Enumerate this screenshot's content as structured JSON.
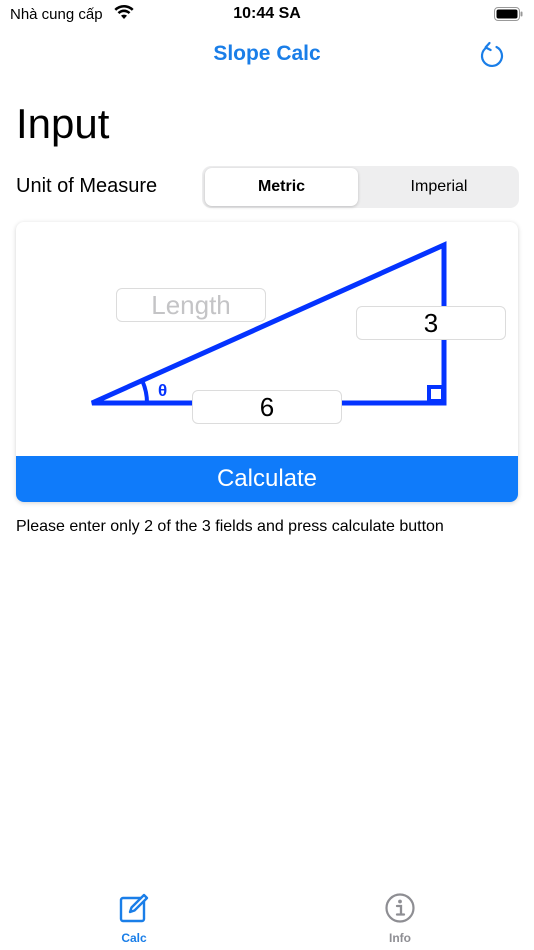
{
  "status": {
    "carrier": "Nhà cung cấp",
    "time": "10:44 SA"
  },
  "nav": {
    "title": "Slope Calc",
    "refresh_icon": "refresh-icon"
  },
  "input": {
    "title": "Input",
    "unit_label": "Unit of Measure",
    "units": [
      "Metric",
      "Imperial"
    ],
    "selected_unit": "Metric"
  },
  "triangle": {
    "angle_symbol": "θ",
    "length_placeholder": "Length",
    "length_value": "",
    "height_value": "3",
    "run_value": "6"
  },
  "calculate_label": "Calculate",
  "hint": "Please enter only 2 of the 3 fields and press calculate button",
  "tabs": [
    {
      "label": "Calc",
      "icon": "edit-icon",
      "active": true
    },
    {
      "label": "Info",
      "icon": "info-icon",
      "active": false
    }
  ],
  "colors": {
    "accent": "#1a7ee8",
    "button": "#0f7bfa",
    "triangle": "#0433ff"
  }
}
